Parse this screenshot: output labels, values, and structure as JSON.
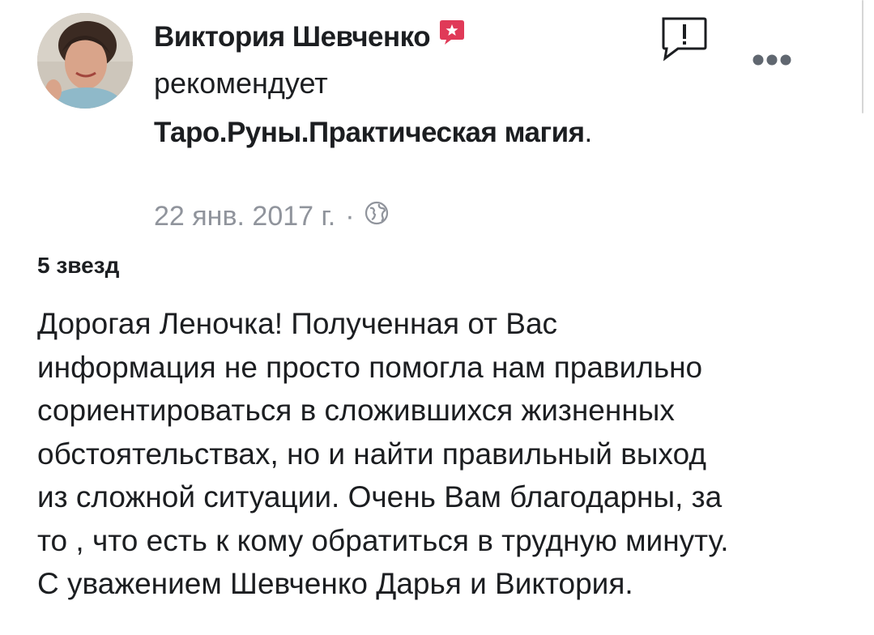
{
  "post": {
    "author": "Виктория Шевченко",
    "action": "рекомендует",
    "page_name": "Таро.Руны.Практическая магия",
    "page_suffix": ".",
    "date": "22 янв. 2017 г.",
    "separator": "·",
    "privacy_icon": "globe-icon",
    "badge_icon": "recommendation-star-icon",
    "rating": "5 звезд",
    "review_lines": [
      "Дорогая Леночка! Полученная от Вас",
      "информация не просто помогла нам правильно",
      "сориентироваться в сложившихся жизненных",
      "обстоятельствах, но и найти правильный выход",
      "из сложной ситуации. Очень Вам благодарны, за",
      "то , что есть к кому обратиться в трудную минуту.",
      "С уважением Шевченко Дарья и Виктория."
    ]
  },
  "actions": {
    "report_icon": "report-flag-icon",
    "more_icon": "more-options-icon"
  },
  "colors": {
    "text": "#1c1e21",
    "meta": "#90949c",
    "badge": "#e03a58"
  }
}
